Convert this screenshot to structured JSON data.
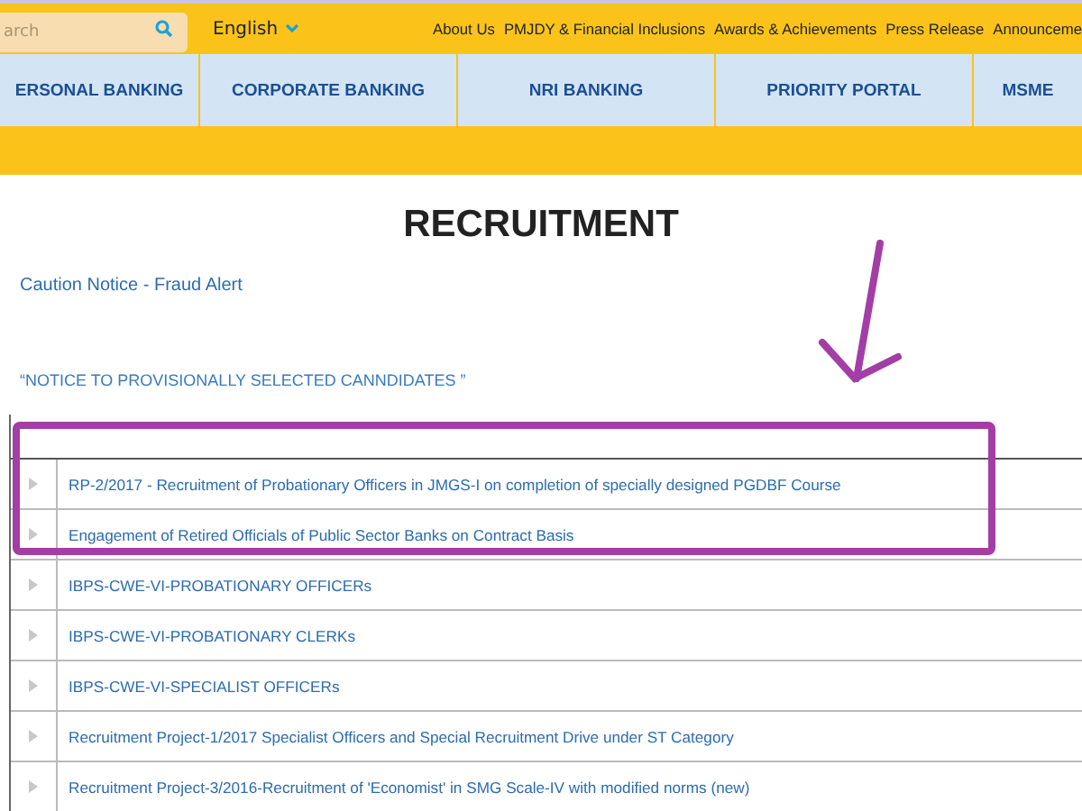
{
  "top_bar": {
    "search": {
      "placeholder": "arch"
    },
    "language": "English",
    "links": [
      "About Us",
      "PMJDY & Financial Inclusions",
      "Awards & Achievements",
      "Press Release",
      "Announceme"
    ]
  },
  "nav": [
    "ERSONAL BANKING",
    "CORPORATE BANKING",
    "NRI BANKING",
    "PRIORITY PORTAL",
    "MSME"
  ],
  "title": "RECRUITMENT",
  "caution_link": "Caution Notice - Fraud Alert",
  "notice_link": "“NOTICE TO PROVISIONALLY SELECTED CANNDIDATES ”",
  "rows": [
    {
      "text": "RP-2/2017 - Recruitment of Probationary Officers in JMGS-I on completion of specially designed PGDBF Course"
    },
    {
      "text": "Engagement of Retired Officials of Public Sector Banks on Contract Basis"
    },
    {
      "text": "IBPS-CWE-VI-PROBATIONARY OFFICERs"
    },
    {
      "text": "IBPS-CWE-VI-PROBATIONARY CLERKs"
    },
    {
      "text": "IBPS-CWE-VI-SPECIALIST OFFICERs"
    },
    {
      "text": "Recruitment Project-1/2017 Specialist Officers and Special Recruitment Drive under ST Category"
    },
    {
      "text": "Recruitment Project-3/2016-Recruitment of 'Economist' in SMG Scale-IV with modified norms (new)"
    }
  ]
}
